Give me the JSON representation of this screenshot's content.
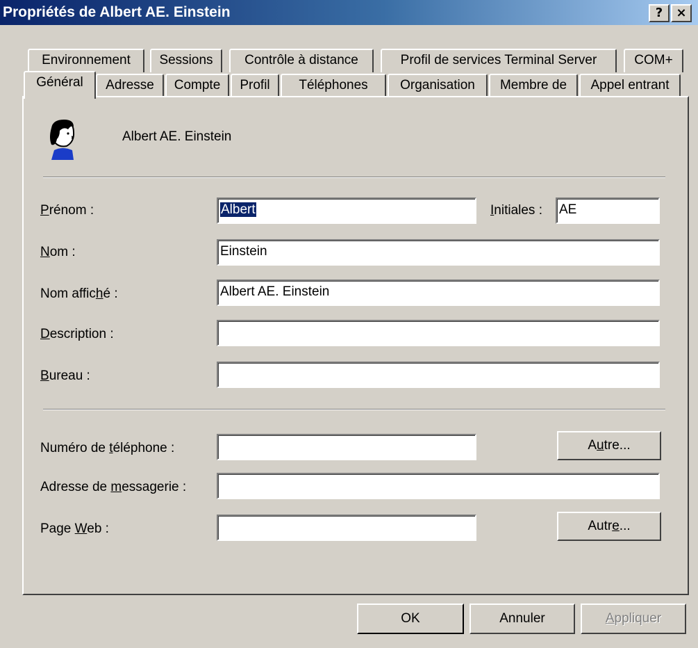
{
  "window": {
    "title": "Propriétés de Albert AE. Einstein",
    "help_glyph": "?",
    "close_glyph": "×"
  },
  "tabs_row1": [
    "Environnement",
    "Sessions",
    "Contrôle à distance",
    "Profil de services Terminal Server",
    "COM+"
  ],
  "tabs_row2": [
    "Général",
    "Adresse",
    "Compte",
    "Profil",
    "Téléphones",
    "Organisation",
    "Membre de",
    "Appel entrant"
  ],
  "active_tab": "Général",
  "user": {
    "display": "Albert AE. Einstein"
  },
  "fields": {
    "prenom": {
      "label_u": "P",
      "label_rest": "rénom :",
      "value": "Albert"
    },
    "initiales": {
      "label_u": "I",
      "label_rest": "nitiales :",
      "value": "AE"
    },
    "nom": {
      "label_u": "N",
      "label_rest": "om :",
      "value": "Einstein"
    },
    "nom_affiche": {
      "label_pre": "Nom affic",
      "label_u": "h",
      "label_rest": "é :",
      "value": "Albert AE. Einstein"
    },
    "description": {
      "label_u": "D",
      "label_rest": "escription :",
      "value": ""
    },
    "bureau": {
      "label_u": "B",
      "label_rest": "ureau :",
      "value": ""
    },
    "telephone": {
      "label_pre": "Numéro de ",
      "label_u": "t",
      "label_rest": "éléphone :",
      "value": ""
    },
    "messagerie": {
      "label_pre": "Adresse de ",
      "label_u": "m",
      "label_rest": "essagerie :",
      "value": ""
    },
    "page_web": {
      "label_pre": "Page ",
      "label_u": "W",
      "label_rest": "eb :",
      "value": ""
    }
  },
  "buttons": {
    "autre_phone": {
      "pre": "A",
      "u": "u",
      "rest": "tre..."
    },
    "autre_web": {
      "pre": "Autr",
      "u": "e",
      "rest": "..."
    },
    "ok": "OK",
    "annuler": "Annuler",
    "appliquer": {
      "u": "A",
      "rest": "ppliquer"
    }
  }
}
